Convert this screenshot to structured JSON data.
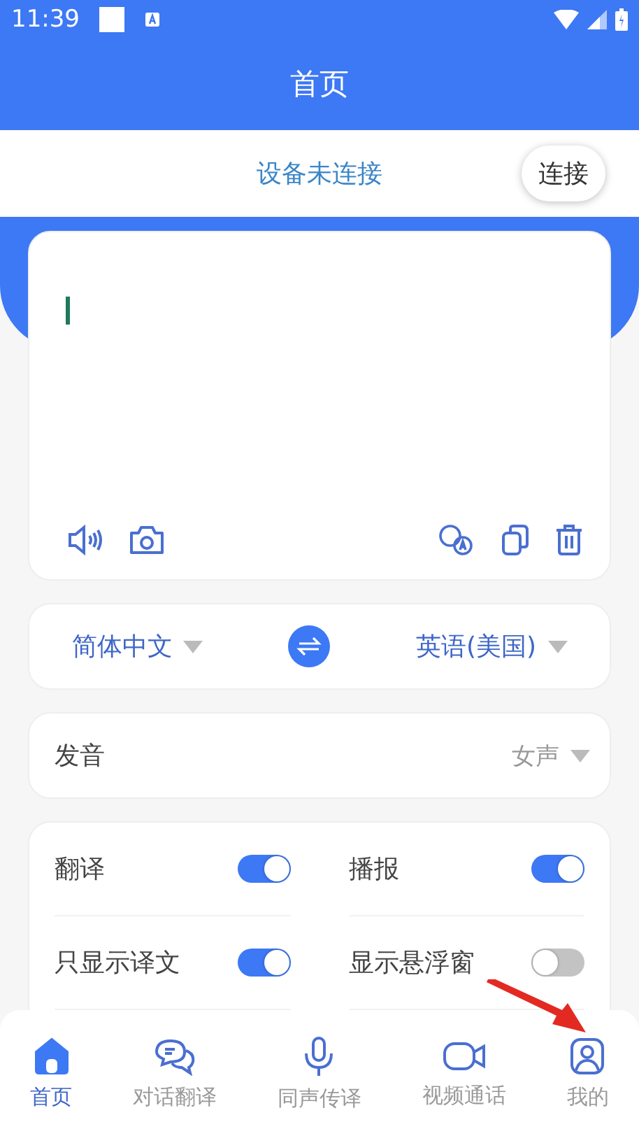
{
  "status_bar": {
    "time": "11:39"
  },
  "header": {
    "title": "首页"
  },
  "device": {
    "status": "设备未连接",
    "button": "连接"
  },
  "source_lang": "简体中文",
  "target_lang": "英语(美国)",
  "voice": {
    "label": "发音",
    "value": "女声"
  },
  "toggles": [
    {
      "label": "翻译",
      "on": true
    },
    {
      "label": "播报",
      "on": true
    },
    {
      "label": "只显示译文",
      "on": true
    },
    {
      "label": "显示悬浮窗",
      "on": false
    }
  ],
  "nav": [
    {
      "label": "首页",
      "kind": "home",
      "selected": true
    },
    {
      "label": "对话翻译",
      "kind": "chat",
      "selected": false
    },
    {
      "label": "同声传译",
      "kind": "mic",
      "selected": false
    },
    {
      "label": "视频通话",
      "kind": "video",
      "selected": false
    },
    {
      "label": "我的",
      "kind": "profile",
      "selected": false
    }
  ]
}
